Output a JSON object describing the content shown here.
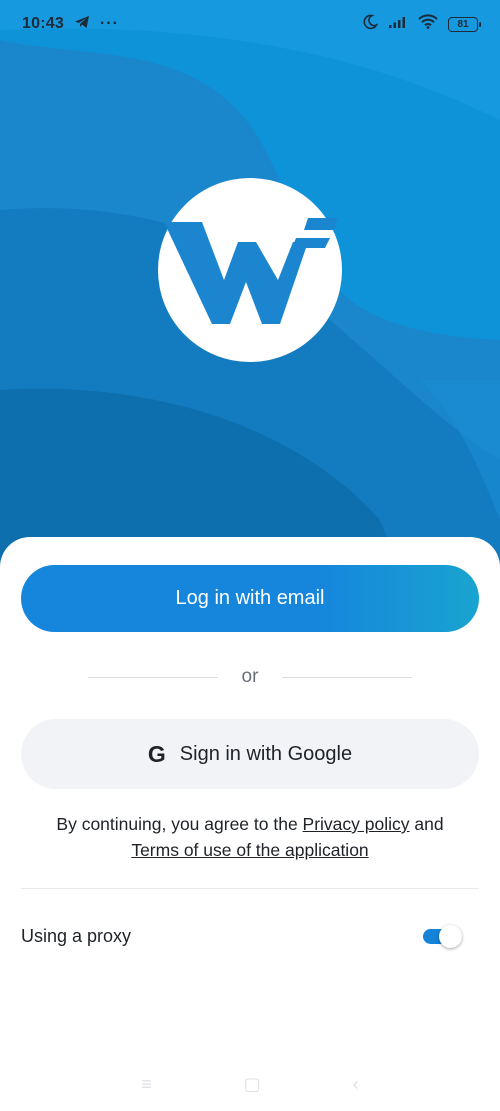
{
  "status_bar": {
    "time": "10:43",
    "notification_icon": "telegram-icon",
    "more": "···",
    "battery_level": "81",
    "icons": [
      "moon-icon",
      "signal-icon",
      "wifi-icon",
      "battery-icon"
    ]
  },
  "brand": {
    "logo_icon": "w-logo-icon",
    "accent_color": "#1686dd"
  },
  "login": {
    "email_button_label": "Log in with email",
    "or_label": "or",
    "google_icon": "G",
    "google_button_label": "Sign in with Google"
  },
  "terms": {
    "prefix": "By continuing, you agree to the ",
    "privacy_link": "Privacy policy",
    "middle": " and",
    "terms_link": "Terms of use of the application"
  },
  "proxy": {
    "label": "Using a proxy",
    "enabled": true
  },
  "nav": {
    "menu": "≡",
    "home": "▢",
    "back": "‹"
  }
}
